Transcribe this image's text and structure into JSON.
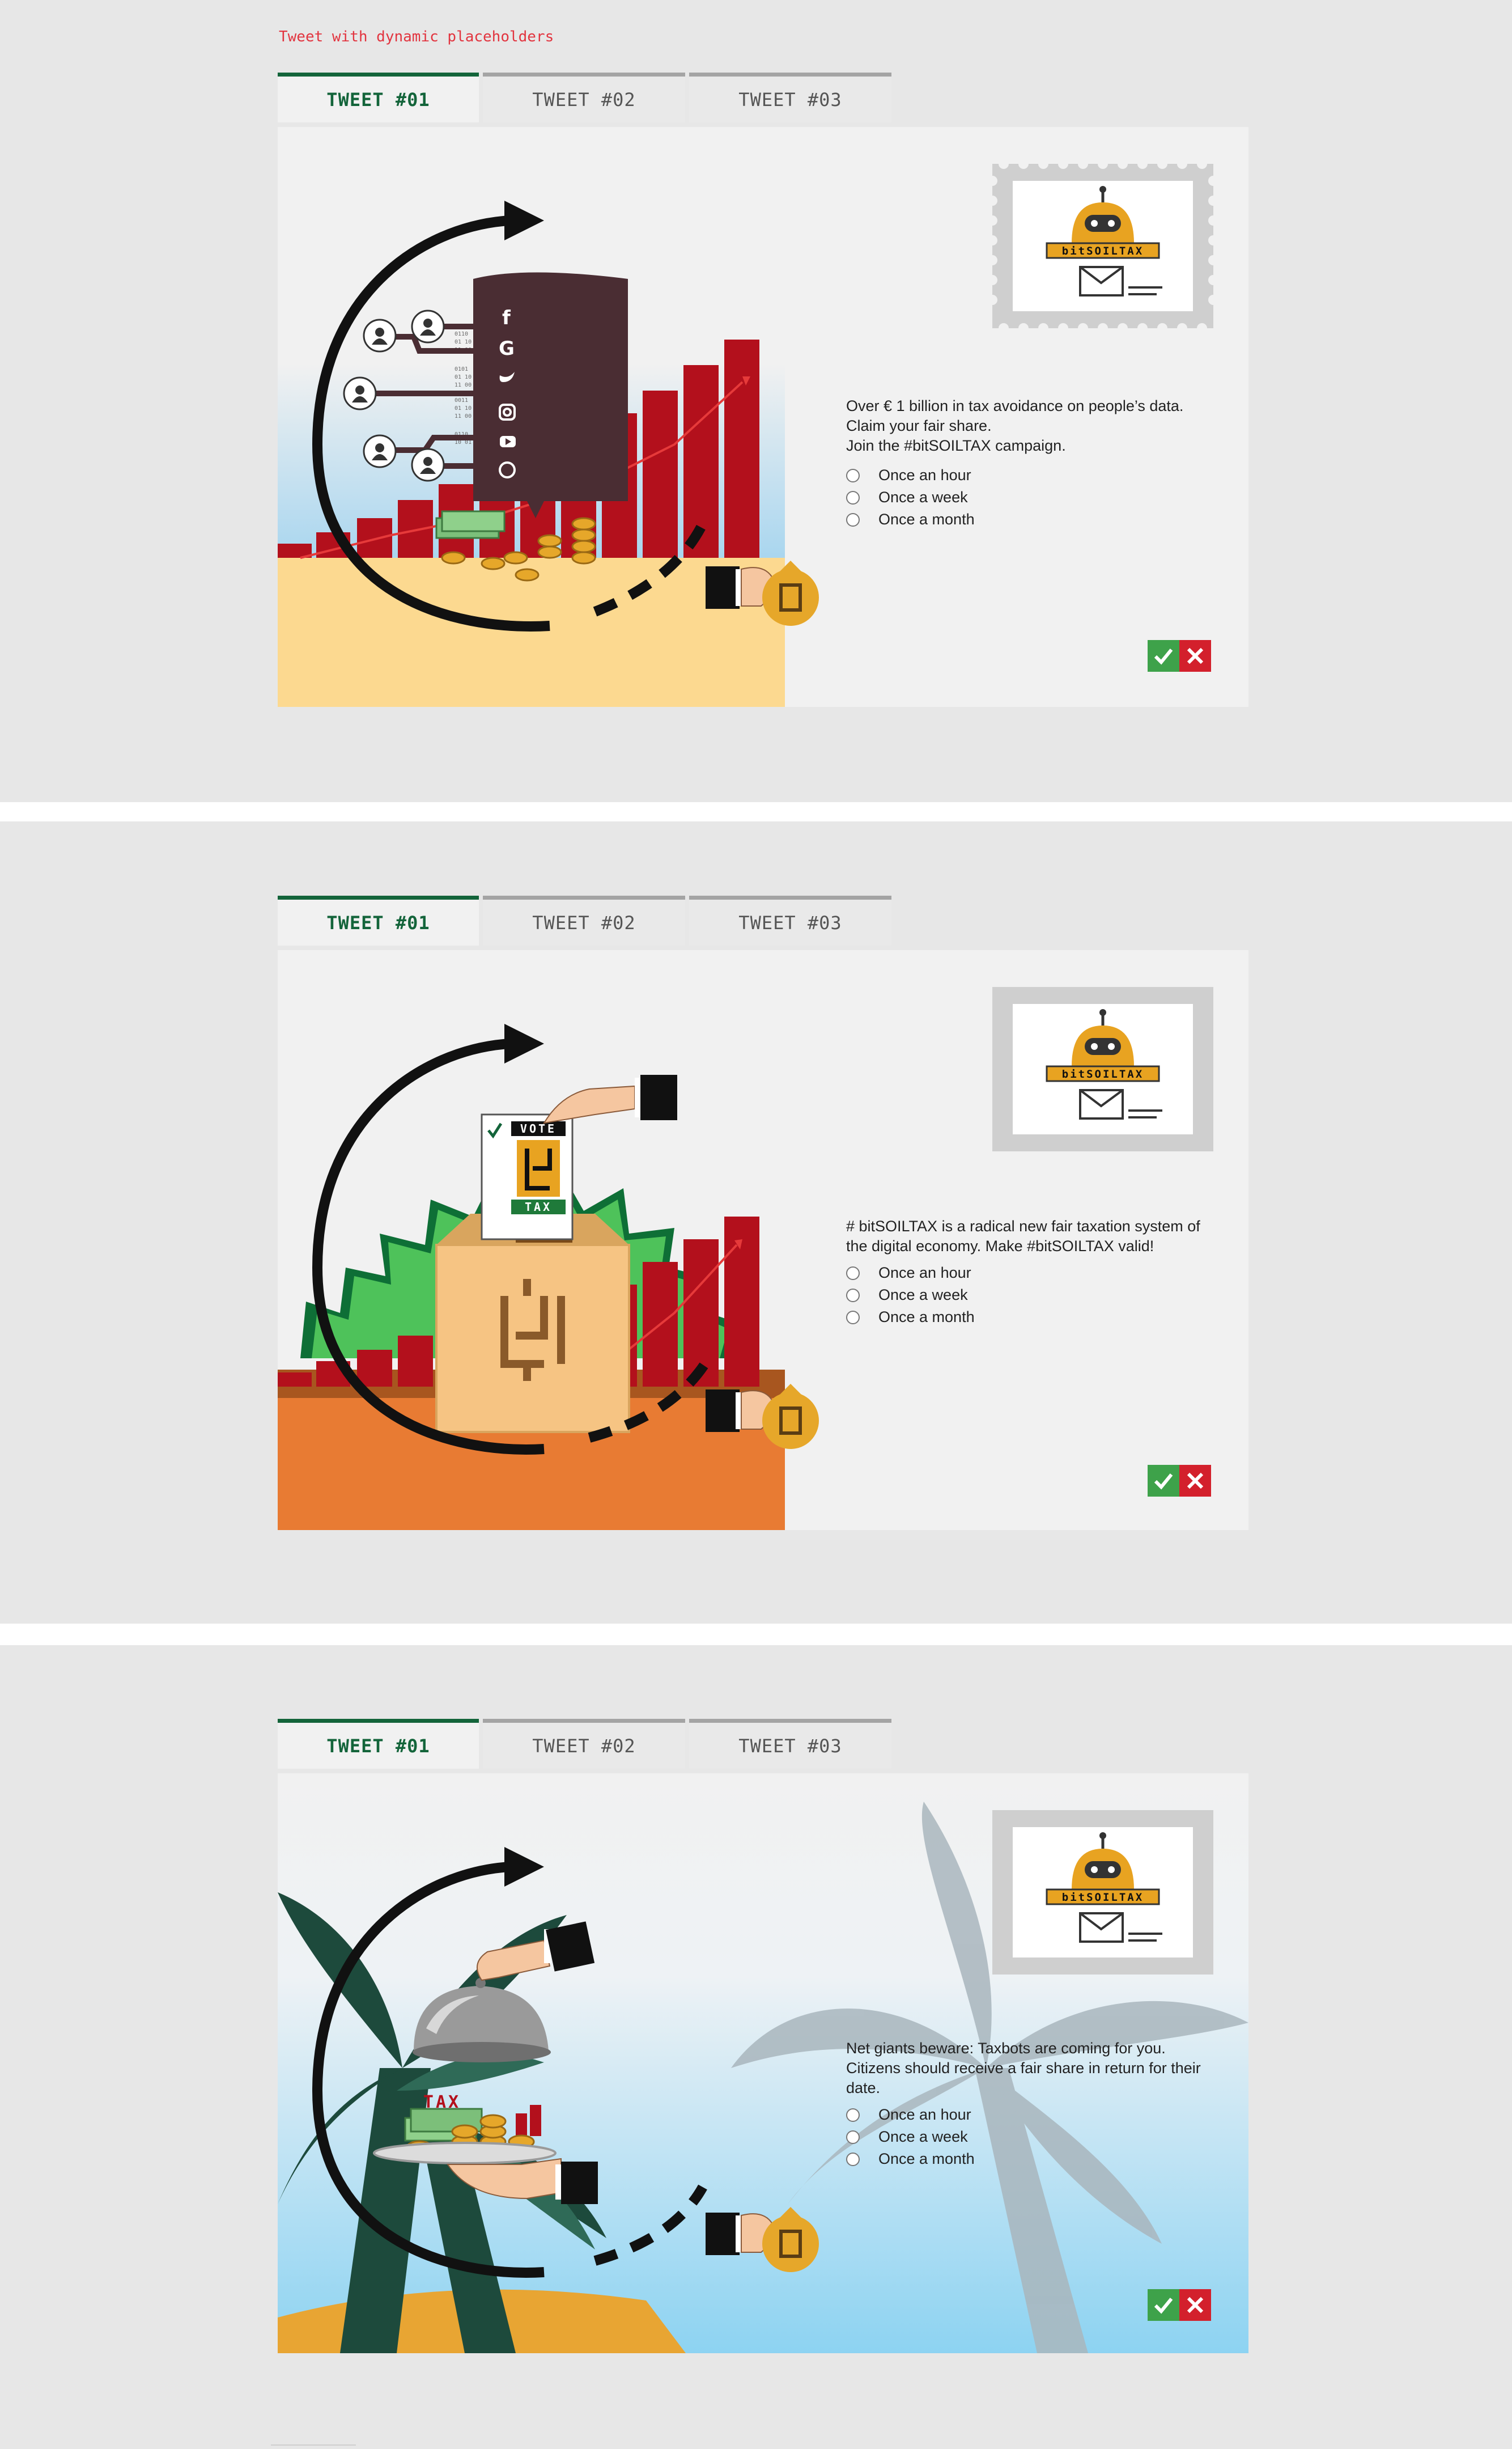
{
  "caption": "Tweet with dynamic placeholders",
  "tabs": [
    "TWEET #01",
    "TWEET #02",
    "TWEET #03"
  ],
  "stamp": {
    "brand": "bitSOILTAX"
  },
  "vote_card": {
    "top": "VOTE",
    "bottom": "TAX"
  },
  "tray_label": "TAX",
  "options": [
    "Once an hour",
    "Once a week",
    "Once a month"
  ],
  "screens": [
    {
      "lines": [
        "Over € 1 billion in tax avoidance on people’s data.",
        "Claim your fair share.",
        "Join the #bitSOILTAX campaign."
      ]
    },
    {
      "lines": [
        "# bitSOILTAX is a radical new fair taxation system of the digital economy.  Make #bitSOILTAX valid!"
      ]
    },
    {
      "lines": [
        "Net giants beware: Taxbots are coming for you. Citizens should receive a fair share in return for their date."
      ]
    }
  ],
  "icons": {
    "approve": "check-icon",
    "reject": "close-icon"
  },
  "colors": {
    "active_tab": "#13643a",
    "approve": "#3ea24a",
    "reject": "#d3202c",
    "caption": "#e2343f"
  }
}
